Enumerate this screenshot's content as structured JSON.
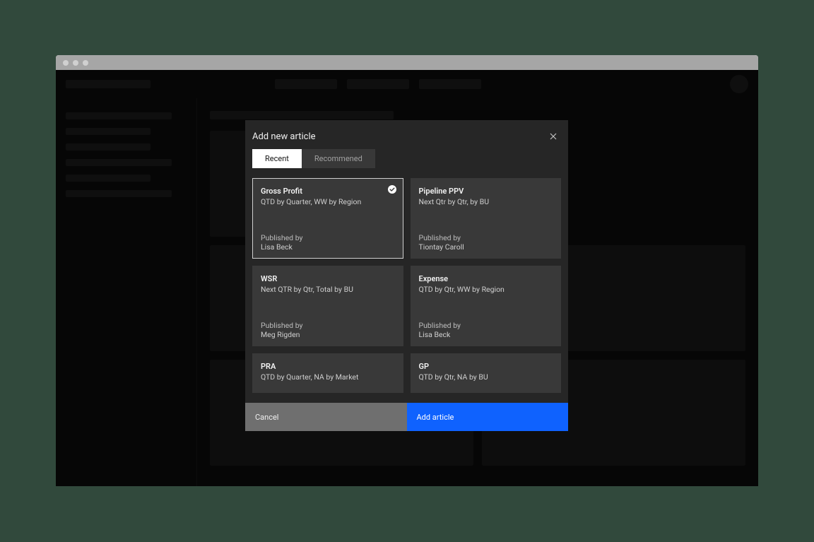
{
  "modal": {
    "title": "Add new article",
    "tabs": {
      "recent": "Recent",
      "recommended": "Recommened"
    },
    "published_label": "Published by",
    "cards": [
      {
        "title": "Gross Profit",
        "subtitle": "QTD by Quarter, WW by Region",
        "publisher": "Lisa Beck",
        "selected": true,
        "has_publisher": true
      },
      {
        "title": "Pipeline PPV",
        "subtitle": "Next Qtr by Qtr, by BU",
        "publisher": "Tiontay Caroll",
        "selected": false,
        "has_publisher": true
      },
      {
        "title": "WSR",
        "subtitle": "Next QTR by Qtr, Total by BU",
        "publisher": "Meg Rigden",
        "selected": false,
        "has_publisher": true
      },
      {
        "title": "Expense",
        "subtitle": "QTD by Qtr, WW by Region",
        "publisher": "Lisa Beck",
        "selected": false,
        "has_publisher": true
      },
      {
        "title": "PRA",
        "subtitle": "QTD by Quarter, NA by Market",
        "publisher": "",
        "selected": false,
        "has_publisher": false
      },
      {
        "title": "GP",
        "subtitle": "QTD by Qtr, NA by BU",
        "publisher": "",
        "selected": false,
        "has_publisher": false
      }
    ],
    "buttons": {
      "cancel": "Cancel",
      "add": "Add article"
    }
  }
}
